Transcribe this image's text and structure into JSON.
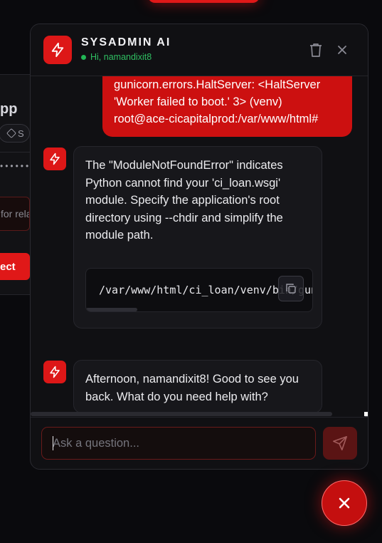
{
  "background": {
    "app_title_fragment": "pp",
    "tag_fragment": "S",
    "masked_dots": "•••••••",
    "input_fragment": "for rela",
    "button_fragment": "ect"
  },
  "header": {
    "title": "SYSADMIN AI",
    "status": "Hi, namandixit8",
    "logo_icon": "lightning-bolt-icon",
    "delete_icon": "trash-icon",
    "close_icon": "close-icon"
  },
  "messages": [
    {
      "role": "user",
      "text": "gunicorn.errors.HaltServer: <HaltServer\n'Worker failed to boot.' 3> (venv)\nroot@ace-cicapitalprod:/var/www/html#"
    },
    {
      "role": "assistant",
      "text": "The \"ModuleNotFoundError\" indicates Python cannot find your 'ci_loan.wsgi' module. Specify the application's root directory using --chdir and simplify the module path.",
      "code": "/var/www/html/ci_loan/venv/bin/gunicorn",
      "copy_icon": "copy-icon"
    },
    {
      "role": "assistant",
      "text": "Afternoon, namandixit8! Good to see you back. What do you need help with?"
    }
  ],
  "input": {
    "placeholder": "Ask a question...",
    "value": "",
    "send_icon": "send-icon"
  },
  "fab": {
    "icon": "close-icon"
  },
  "colors": {
    "accent": "#dd1717",
    "status_green": "#22b655",
    "panel_bg": "#101013"
  }
}
